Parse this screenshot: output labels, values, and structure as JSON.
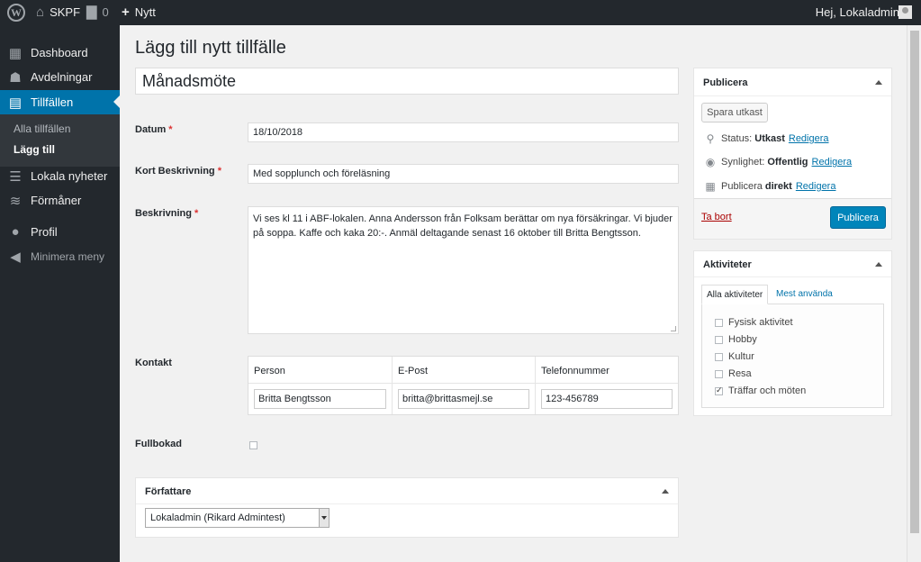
{
  "adminbar": {
    "site_name": "SKPF",
    "comments_count": "0",
    "new_label": "Nytt",
    "howdy": "Hej, Lokaladmin"
  },
  "sidebar": {
    "items": [
      {
        "label": "Dashboard",
        "icon": "dashboard-icon"
      },
      {
        "label": "Avdelningar",
        "icon": "groups-icon"
      },
      {
        "label": "Tillfällen",
        "icon": "calendar-icon"
      },
      {
        "label": "Lokala nyheter",
        "icon": "news-icon"
      },
      {
        "label": "Förmåner",
        "icon": "benefits-icon"
      },
      {
        "label": "Profil",
        "icon": "user-icon"
      }
    ],
    "submenu": [
      "Alla tillfällen",
      "Lägg till"
    ],
    "collapse_label": "Minimera meny"
  },
  "page": {
    "title": "Lägg till nytt tillfälle",
    "post_title": "Månadsmöte"
  },
  "fields": {
    "datum_label": "Datum",
    "datum_value": "18/10/2018",
    "kort_label": "Kort Beskrivning",
    "kort_value": "Med sopplunch och föreläsning",
    "beskrivning_label": "Beskrivning",
    "beskrivning_value": "Vi ses kl 11 i ABF-lokalen. Anna Andersson från Folksam berättar om nya försäkringar. Vi bjuder på soppa. Kaffe och kaka 20:-. Anmäl deltagande senast 16 oktober till Britta Bengtsson.",
    "required_mark": "*",
    "kontakt_label": "Kontakt",
    "kontakt_headers": [
      "Person",
      "E-Post",
      "Telefonnummer"
    ],
    "kontakt_values": [
      "Britta Bengtsson",
      "britta@brittasmejl.se",
      "123-456789"
    ],
    "fullbokad_label": "Fullbokad",
    "fullbokad_checked": false
  },
  "author_box": {
    "title": "Författare",
    "selected": "Lokaladmin (Rikard Admintest)"
  },
  "publish_box": {
    "title": "Publicera",
    "save_draft": "Spara utkast",
    "status_label": "Status:",
    "status_value": "Utkast",
    "visibility_label": "Synlighet:",
    "visibility_value": "Offentlig",
    "publish_label": "Publicera",
    "publish_value": "direkt",
    "edit_link": "Redigera",
    "trash": "Ta bort",
    "publish_button": "Publicera"
  },
  "activities_box": {
    "title": "Aktiviteter",
    "tabs": [
      "Alla aktiviteter",
      "Mest använda"
    ],
    "items": [
      {
        "label": "Fysisk aktivitet",
        "checked": false
      },
      {
        "label": "Hobby",
        "checked": false
      },
      {
        "label": "Kultur",
        "checked": false
      },
      {
        "label": "Resa",
        "checked": false
      },
      {
        "label": "Träffar och möten",
        "checked": true
      }
    ]
  }
}
